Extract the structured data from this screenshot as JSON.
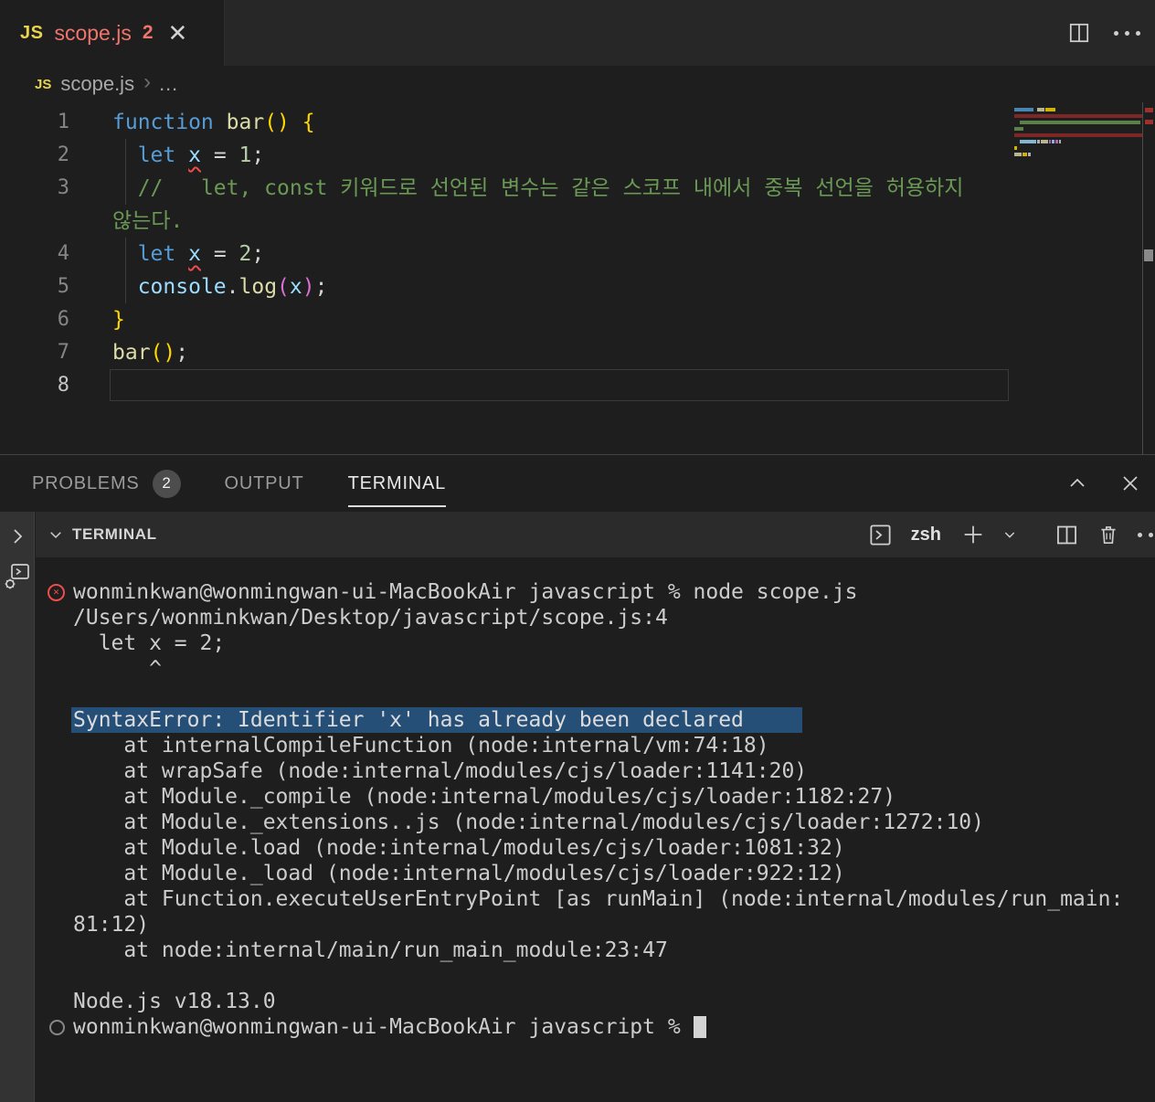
{
  "tab": {
    "icon": "JS",
    "title": "scope.js",
    "error_count": "2",
    "close": "✕"
  },
  "editor_actions": {
    "split_tooltip": "split-editor",
    "more_tooltip": "more-actions"
  },
  "breadcrumb": {
    "icon": "JS",
    "file": "scope.js",
    "separator": "›",
    "more": "…"
  },
  "editor": {
    "colors": {
      "kw": "#569CD6",
      "var": "#9CDCFE",
      "fn": "#DCDCAA",
      "num": "#B5CEA8",
      "com": "#6A9955",
      "fg": "#D4D4D4",
      "b1": "#FFD700",
      "b2": "#DA70D6"
    },
    "rows": [
      {
        "num": "1",
        "segs": [
          [
            "function",
            "kw"
          ],
          [
            " ",
            "fg"
          ],
          [
            "bar",
            "fn"
          ],
          [
            "() {",
            "b1"
          ]
        ]
      },
      {
        "num": "2",
        "guide": true,
        "segs": [
          [
            "  ",
            "fg"
          ],
          [
            "let",
            "kw"
          ],
          [
            " ",
            "fg"
          ],
          [
            "x",
            "var",
            "sq"
          ],
          [
            " = ",
            "fg"
          ],
          [
            "1",
            "num"
          ],
          [
            ";",
            "fg"
          ]
        ]
      },
      {
        "num": "3",
        "guide": true,
        "segs": [
          [
            "  ",
            "fg"
          ],
          [
            "//   let, const 키워드로 선언된 변수는 같은 스코프 내에서 중복 선언을 허용하지",
            "com"
          ]
        ]
      },
      {
        "num": "",
        "segs": [
          [
            "않는다.",
            "com"
          ]
        ]
      },
      {
        "num": "4",
        "guide": true,
        "segs": [
          [
            "  ",
            "fg"
          ],
          [
            "let",
            "kw"
          ],
          [
            " ",
            "fg"
          ],
          [
            "x",
            "var",
            "sq"
          ],
          [
            " = ",
            "fg"
          ],
          [
            "2",
            "num"
          ],
          [
            ";",
            "fg"
          ]
        ]
      },
      {
        "num": "5",
        "guide": true,
        "segs": [
          [
            "  ",
            "fg"
          ],
          [
            "console",
            "var"
          ],
          [
            ".",
            "fg"
          ],
          [
            "log",
            "fn"
          ],
          [
            "(",
            "b2"
          ],
          [
            "x",
            "var"
          ],
          [
            ")",
            "b2"
          ],
          [
            ";",
            "fg"
          ]
        ]
      },
      {
        "num": "6",
        "segs": [
          [
            "}",
            "b1"
          ]
        ]
      },
      {
        "num": "7",
        "segs": [
          [
            "bar",
            "fn"
          ],
          [
            "()",
            "b1"
          ],
          [
            ";",
            "fg"
          ]
        ]
      },
      {
        "num": "8",
        "current": true,
        "segs": []
      }
    ]
  },
  "panel": {
    "tabs": [
      {
        "label": "PROBLEMS",
        "badge": "2",
        "active": false
      },
      {
        "label": "OUTPUT",
        "active": false
      },
      {
        "label": "TERMINAL",
        "active": true
      }
    ]
  },
  "terminal": {
    "title": "TERMINAL",
    "shell": "zsh",
    "status_colors": {
      "error": "#F14C4C",
      "selection": "#264F78"
    },
    "lines": [
      {
        "text": "wonminkwan@wonmingwan-ui-MacBookAir javascript % node scope.js",
        "gutter": "error"
      },
      {
        "text": "/Users/wonminkwan/Desktop/javascript/scope.js:4"
      },
      {
        "text": "  let x = 2;"
      },
      {
        "text": "      ^"
      },
      {
        "text": ""
      },
      {
        "text": "SyntaxError: Identifier 'x' has already been declared",
        "selected": true
      },
      {
        "text": "    at internalCompileFunction (node:internal/vm:74:18)"
      },
      {
        "text": "    at wrapSafe (node:internal/modules/cjs/loader:1141:20)"
      },
      {
        "text": "    at Module._compile (node:internal/modules/cjs/loader:1182:27)"
      },
      {
        "text": "    at Module._extensions..js (node:internal/modules/cjs/loader:1272:10)"
      },
      {
        "text": "    at Module.load (node:internal/modules/cjs/loader:1081:32)"
      },
      {
        "text": "    at Module._load (node:internal/modules/cjs/loader:922:12)"
      },
      {
        "text": "    at Function.executeUserEntryPoint [as runMain] (node:internal/modules/run_main:"
      },
      {
        "text": "81:12)"
      },
      {
        "text": "    at node:internal/main/run_main_module:23:47"
      },
      {
        "text": ""
      },
      {
        "text": "Node.js v18.13.0"
      },
      {
        "text": "wonminkwan@wonmingwan-ui-MacBookAir javascript % ",
        "gutter": "prompt",
        "cursor": true
      }
    ]
  }
}
